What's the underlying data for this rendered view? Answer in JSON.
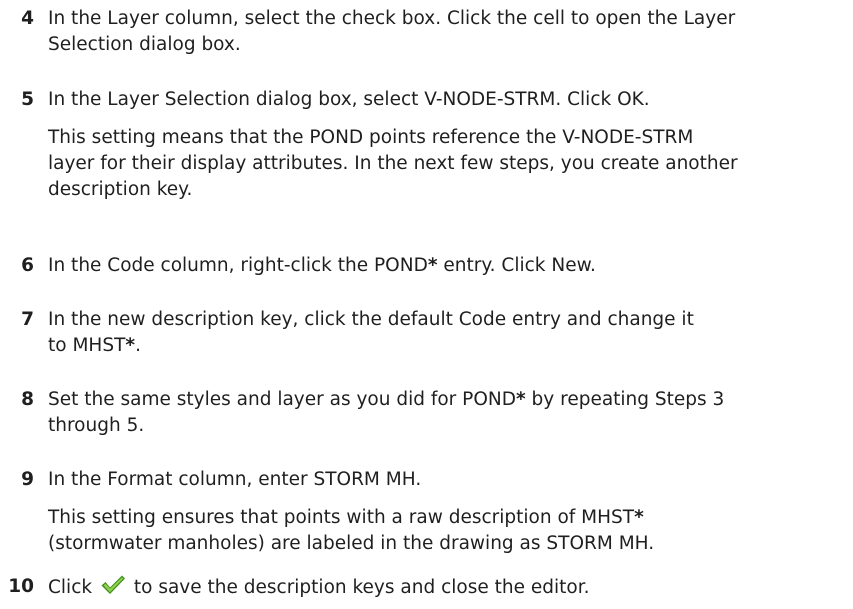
{
  "steps": [
    {
      "number": "4",
      "lines": [
        "In the Layer column, select the check box. Click the cell to open the Layer",
        "Selection dialog box."
      ]
    },
    {
      "number": "5",
      "lines": [
        "In the Layer Selection dialog box, select V-NODE-STRM. Click OK."
      ],
      "note_lines": [
        "This setting means that the POND points reference the V-NODE-STRM",
        "layer for their display attributes. In the next few steps, you create another",
        "description key."
      ]
    },
    {
      "number": "6",
      "text_before": "In the Code column, right-click the POND",
      "star": "*",
      "text_after": " entry. Click New."
    },
    {
      "number": "7",
      "line1": "In the new description key, click the default Code entry and change it",
      "line2_before": "to MHST",
      "star": "*",
      "line2_after": "."
    },
    {
      "number": "8",
      "line1_before": "Set the same styles and layer as you did for POND",
      "star": "*",
      "line1_after": " by repeating Steps 3",
      "line2": "through 5."
    },
    {
      "number": "9",
      "line1": "In the Format column, enter STORM MH.",
      "note_line1_before": "This setting ensures that points with a raw description of MHST",
      "star": "*",
      "note_line2": "(stormwater manholes) are labeled in the drawing as STORM MH."
    },
    {
      "number": "10",
      "text_before": "Click",
      "icon": "green-checkmark-icon",
      "text_after": "to save the description keys and close the editor."
    }
  ],
  "colors": {
    "text": "#1f1f1f",
    "check_dark": "#3f8f1a",
    "check_light": "#8fd14f"
  }
}
